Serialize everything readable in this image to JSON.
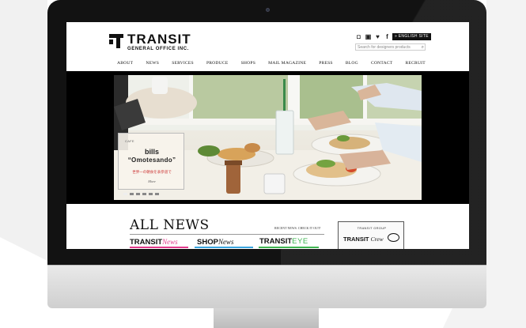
{
  "site": {
    "logo_name": "TRANSIT",
    "logo_sub": "GENERAL OFFICE INC.",
    "social_icons": [
      "instagram-icon",
      "vimeo-icon",
      "twitter-icon",
      "facebook-icon"
    ],
    "english_site": "ENGLISH SITE",
    "search_placeholder": "Search for designers products",
    "nav": [
      "ABOUT",
      "NEWS",
      "SERVICES",
      "PRODUCE",
      "SHOPS",
      "MAIL MAGAZINE",
      "PRESS",
      "BLOG",
      "CONTACT",
      "RECRUIT"
    ]
  },
  "hero": {
    "card_kicker": "CAFE",
    "card_name1": "bills",
    "card_name2": "“Omotesando”",
    "card_jp": "世界一の朝食を表参道で",
    "card_more": "More",
    "slide_count": 6,
    "active_slide": 1
  },
  "news": {
    "heading": "ALL NEWS",
    "recent_label": "RECENT NEWS. CHECK IT OUT!",
    "brands": [
      {
        "main": "TRANSIT",
        "script": "News",
        "color": "#e23a8c"
      },
      {
        "main": "SHOP",
        "script": "News",
        "color": "#3aa5df"
      },
      {
        "main": "TRANSIT",
        "script": "EYE",
        "color": "#3fb552"
      }
    ],
    "crew_group": "TRANSIT GROUP",
    "crew_main": "TRANSIT",
    "crew_script": "Crew"
  },
  "colors": {
    "bezel": "#121212",
    "accent_news": "#e23a8c",
    "accent_shop": "#3aa5df",
    "accent_eye": "#3fb552"
  }
}
